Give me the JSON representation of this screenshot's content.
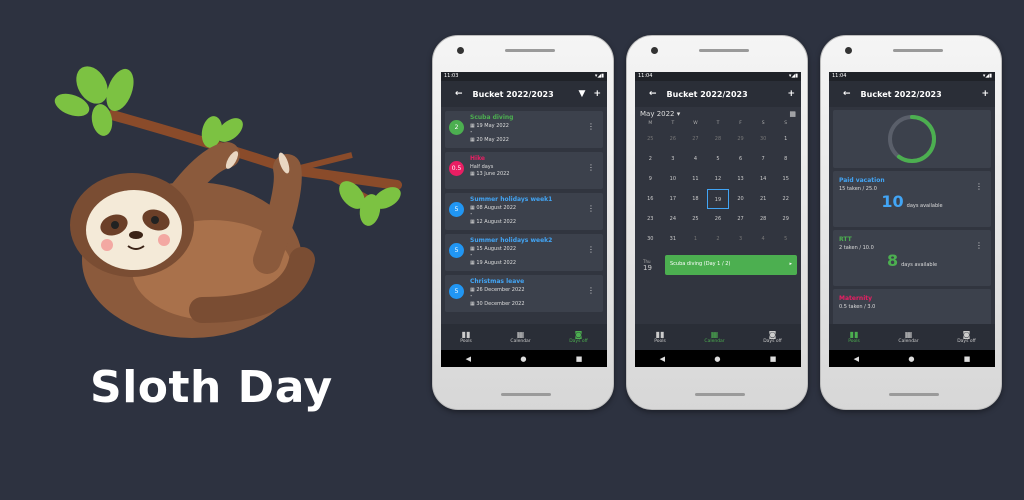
{
  "branding": {
    "title": "Sloth Day"
  },
  "phones": [
    {
      "status_time": "11:03",
      "appbar_title": "Bucket 2022/2023",
      "items": [
        {
          "badge": "2",
          "badge_color": "#4caf50",
          "name": "Scuba diving",
          "name_color": "#4caf50",
          "line1": "19 May 2022",
          "line2": "20 May 2022"
        },
        {
          "badge": "0.5",
          "badge_color": "#e91e63",
          "name": "Hike",
          "name_color": "#e91e63",
          "line1": "Half days",
          "line2": "13 June 2022"
        },
        {
          "badge": "5",
          "badge_color": "#2196f3",
          "name": "Summer holidays week1",
          "name_color": "#42a5f5",
          "line1": "08 August 2022",
          "line2": "12 August 2022"
        },
        {
          "badge": "5",
          "badge_color": "#2196f3",
          "name": "Summer holidays week2",
          "name_color": "#42a5f5",
          "line1": "15 August 2022",
          "line2": "19 August 2022"
        },
        {
          "badge": "5",
          "badge_color": "#2196f3",
          "name": "Christmas leave",
          "name_color": "#42a5f5",
          "line1": "26 December 2022",
          "line2": "30 December 2022"
        }
      ],
      "bottom_nav": [
        "Pools",
        "Calendar",
        "Days off"
      ],
      "active_tab": 2
    },
    {
      "status_time": "11:04",
      "appbar_title": "Bucket 2022/2023",
      "month": "May 2022",
      "weekdays": [
        "M",
        "T",
        "W",
        "T",
        "F",
        "S",
        "S"
      ],
      "weeks": [
        [
          "25",
          "26",
          "27",
          "28",
          "29",
          "30",
          "1"
        ],
        [
          "2",
          "3",
          "4",
          "5",
          "6",
          "7",
          "8"
        ],
        [
          "9",
          "10",
          "11",
          "12",
          "13",
          "14",
          "15"
        ],
        [
          "16",
          "17",
          "18",
          "19",
          "20",
          "21",
          "22"
        ],
        [
          "23",
          "24",
          "25",
          "26",
          "27",
          "28",
          "29"
        ],
        [
          "30",
          "31",
          "1",
          "2",
          "3",
          "4",
          "5"
        ]
      ],
      "event_day_label": "Thu",
      "event_day": "19",
      "event_text": "Scuba diving (Day 1 / 2)",
      "bottom_nav": [
        "Pools",
        "Calendar",
        "Days off"
      ],
      "active_tab": 1
    },
    {
      "status_time": "11:04",
      "appbar_title": "Bucket 2022/2023",
      "gauge_fraction": 0.6,
      "pools": [
        {
          "name": "Paid vacation",
          "name_color": "#42a5f5",
          "detail": "15 taken / 25.0",
          "available": "10",
          "available_label": "days available",
          "num_color": "#42a5f5"
        },
        {
          "name": "RTT",
          "name_color": "#4caf50",
          "detail": "2 taken / 10.0",
          "available": "8",
          "available_label": "days available",
          "num_color": "#4caf50"
        },
        {
          "name": "Maternity",
          "name_color": "#e91e63",
          "detail": "0.5 taken / 3.0"
        }
      ],
      "bottom_nav": [
        "Pools",
        "Calendar",
        "Days off"
      ],
      "active_tab": 0
    }
  ]
}
